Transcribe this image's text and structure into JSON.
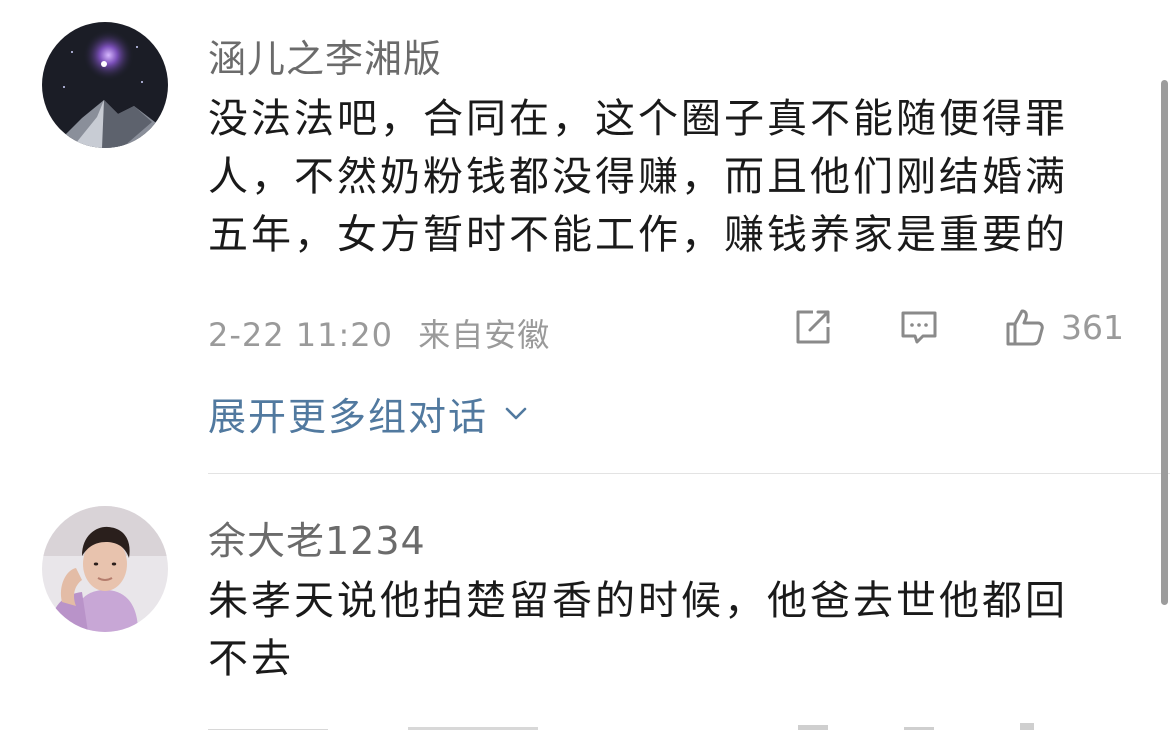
{
  "comments": [
    {
      "username": "涵儿之李湘版",
      "lines": [
        "没法法吧，合同在，这个圈子真不能随便得罪",
        "人，不然奶粉钱都没得赚，而且他们刚结婚满",
        "五年，女方暂时不能工作，赚钱养家是重要的"
      ],
      "time": "2-22 11:20",
      "location": "来自安徽",
      "likes": "361",
      "expand_label": "展开更多组对话"
    },
    {
      "username": "余大老1234",
      "lines": [
        "朱孝天说他拍楚留香的时候，他爸去世他都回",
        "不去"
      ]
    }
  ],
  "icons": {
    "share": "share-icon",
    "comment": "comment-icon",
    "like": "thumbs-up-icon",
    "expand": "chevron-down-icon"
  },
  "colors": {
    "username": "#6b6b6b",
    "text": "#1a1a1a",
    "meta": "#9a9a9a",
    "link": "#51799f",
    "divider": "#e3e3e3"
  }
}
